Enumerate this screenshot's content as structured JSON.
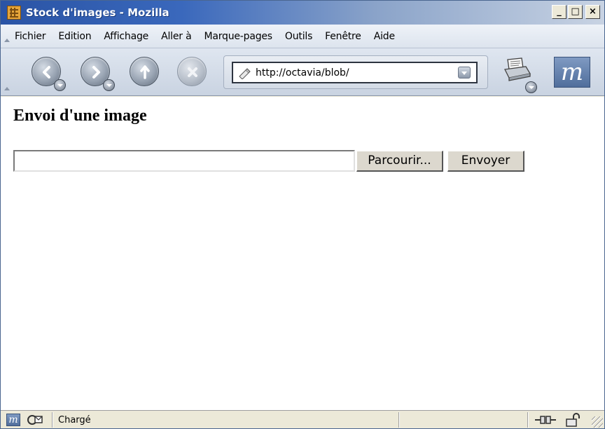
{
  "window": {
    "title": "Stock d'images - Mozilla",
    "buttons": {
      "minimize": "_",
      "maximize": "□",
      "close": "×"
    }
  },
  "menu": {
    "items": [
      "Fichier",
      "Edition",
      "Affichage",
      "Aller à",
      "Marque-pages",
      "Outils",
      "Fenêtre",
      "Aide"
    ]
  },
  "toolbar": {
    "icons": [
      "back-icon",
      "forward-icon",
      "reload-icon",
      "stop-icon",
      "print-icon"
    ],
    "url": "http://octavia/blob/",
    "logo": "m"
  },
  "page": {
    "heading": "Envoi d'une image",
    "file_value": "",
    "browse_label": "Parcourir...",
    "submit_label": "Envoyer"
  },
  "status": {
    "text": "Chargé",
    "logo": "m"
  },
  "colors": {
    "title_gradient_start": "#2a54a5",
    "title_gradient_end": "#c8d3e3",
    "chrome": "#ece9d8",
    "toolbar": "#c9d3e1"
  }
}
